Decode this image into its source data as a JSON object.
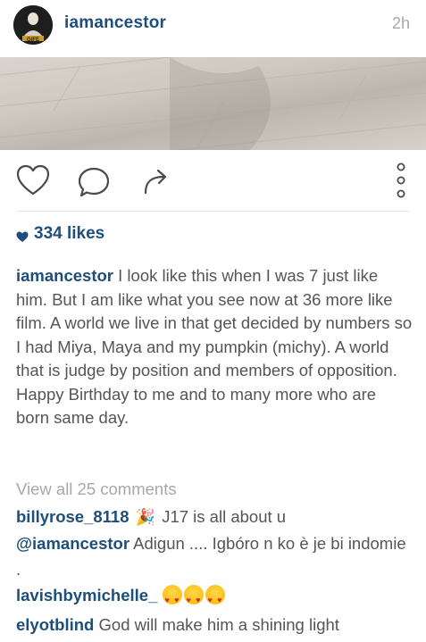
{
  "post": {
    "username": "iamancestor",
    "timestamp": "2h",
    "avatar_text": "GIFE"
  },
  "actions": {
    "like_icon": "heart-outline-icon",
    "comment_icon": "comment-bubble-icon",
    "share_icon": "share-arrow-icon",
    "more_icon": "vertical-dots-icon"
  },
  "likes": {
    "count_label": "334 likes"
  },
  "caption": {
    "username": "iamancestor",
    "text": " I look like this when I was 7 just like him. But I am like what you see now at 36 more like film. A world we live in that get decided by numbers so I had Miya, Maya and my pumpkin (michy). A world that is judge by position and members of opposition. Happy Birthday to me and to many more who are born same day."
  },
  "comments": {
    "view_all": "View all 25 comments",
    "items": [
      {
        "username": "billyrose_8118",
        "emoji": "🎉",
        "text": " J17 is all about u ",
        "mention": "@iamancestor",
        "text2": "  Adigun .... Igbóro n ko è je  bi indomie ."
      },
      {
        "username": "lavishbymichelle_",
        "text": ""
      },
      {
        "username": "elyotblind",
        "text": " God will make him a shining light"
      }
    ]
  },
  "colors": {
    "username": "#1c4f7b",
    "body_text": "#555555",
    "muted": "#a8a8a8"
  }
}
